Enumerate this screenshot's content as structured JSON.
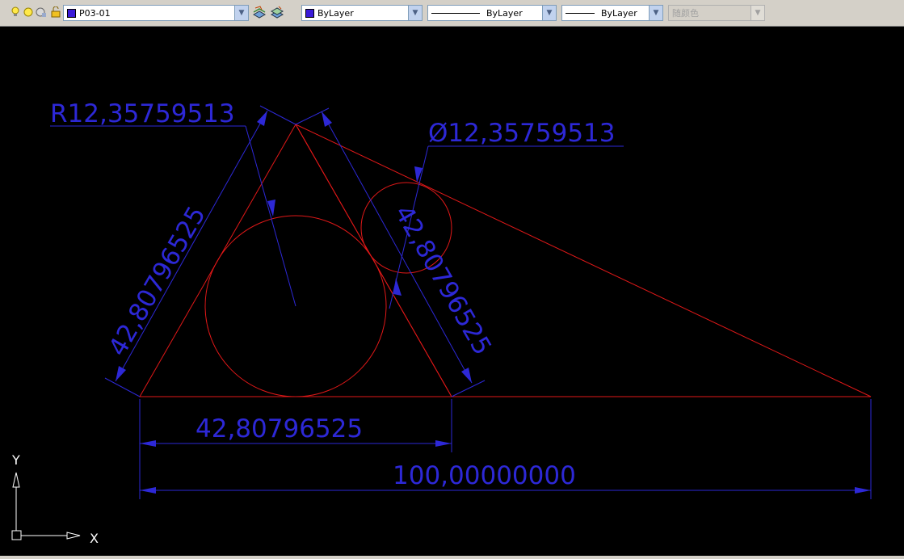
{
  "toolbar": {
    "layer_name": "P03-01",
    "layer_color": "#3a1ad8",
    "color_dropdown": "ByLayer",
    "linetype_dropdown": "ByLayer",
    "lineweight_dropdown": "ByLayer",
    "plotstyle_dropdown": "随颜色"
  },
  "drawing": {
    "radius_label": "R12,35759513",
    "diameter_label": "Ø12,35759513",
    "left_side_label": "42,80796525",
    "right_side_label": "42,80796525",
    "base_label": "42,80796525",
    "total_label": "100,00000000",
    "dim_color": "#2d28d6",
    "geometry_color": "#e01818"
  },
  "ucs": {
    "x_label": "X",
    "y_label": "Y"
  }
}
